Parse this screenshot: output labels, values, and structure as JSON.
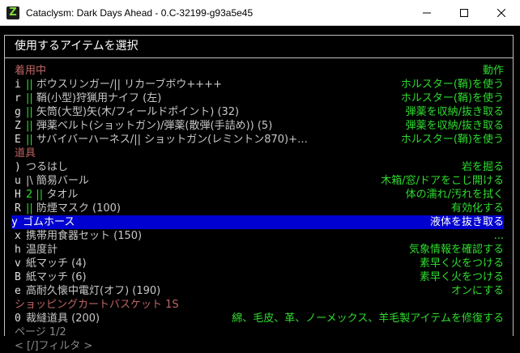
{
  "window": {
    "title": "Cataclysm: Dark Days Ahead - 0.C-32199-g93a5e45",
    "icon_letter": "Z",
    "icon_name": "cdda-icon"
  },
  "menu": {
    "header": "使用するアイテムを選択",
    "categories": {
      "worn": "着用中",
      "action_header": "動作",
      "items": "道具",
      "cart": "ショッピングカートバスケット 1S"
    },
    "worn_items": [
      {
        "key": "i",
        "bars": "||",
        "name": "ボウスリンガー/|| リカーブボウ++++",
        "action": "ホルスター(鞘)を使う"
      },
      {
        "key": "r",
        "bars": "||",
        "name": "鞘(小型)狩猟用ナイフ (左)",
        "action": "ホルスター(鞘)を使う"
      },
      {
        "key": "g",
        "bars": "||",
        "name": "矢筒(大型)矢(木/フィールドポイント) (32)",
        "action": "弾薬を収納/抜き取る"
      },
      {
        "key": "Z",
        "bars": "||",
        "name": "弾薬ベルト(ショットガン)/弾薬(散弾(手詰め)) (5)",
        "action": "弾薬を収納/抜き取る"
      },
      {
        "key": "E",
        "bars": "||",
        "name": "サバイバーハーネス/|| ショットガン(レミントン870)+…",
        "action": "ホルスター(鞘)を使う"
      }
    ],
    "tool_items": [
      {
        "key": ")",
        "bars": "",
        "name": "つるはし",
        "action": "岩を掘る"
      },
      {
        "key": "u",
        "bars": "|\\",
        "name": "簡易バール",
        "action": "木箱/窓/ドアをこじ開ける"
      },
      {
        "key": "H",
        "bars": "2 ||",
        "name": "タオル",
        "action": "体の濡れ/汚れを拭く"
      },
      {
        "key": "R",
        "bars": "||",
        "name": "防煙マスク (100)",
        "action": "有効化する"
      },
      {
        "key": "y",
        "bars": "",
        "name": "ゴムホース",
        "action": "液体を抜き取る"
      },
      {
        "key": "x",
        "bars": "",
        "name": "携帯用食器セット (150)",
        "action": "..."
      },
      {
        "key": "h",
        "bars": "",
        "name": "温度計",
        "action": "気象情報を確認する"
      },
      {
        "key": "v",
        "bars": "",
        "name": "紙マッチ (4)",
        "action": "素早く火をつける"
      },
      {
        "key": "B",
        "bars": "",
        "name": "紙マッチ (6)",
        "action": "素早く火をつける"
      },
      {
        "key": "e",
        "bars": "",
        "name": "高耐久懐中電灯(オフ) (190)",
        "action": "オンにする"
      }
    ],
    "cart_items": [
      {
        "key": "0",
        "bars": "",
        "name": "裁縫道具 (200)",
        "action": "綿、毛皮、革、ノーメックス、羊毛製アイテムを修復する"
      }
    ],
    "footer": {
      "page": "ページ 1/2",
      "filter": "< [/]フィルタ >"
    }
  },
  "colors": {
    "accent_green": "#2edc2e",
    "category_red": "#c06464",
    "selection_blue": "#0000d0"
  }
}
